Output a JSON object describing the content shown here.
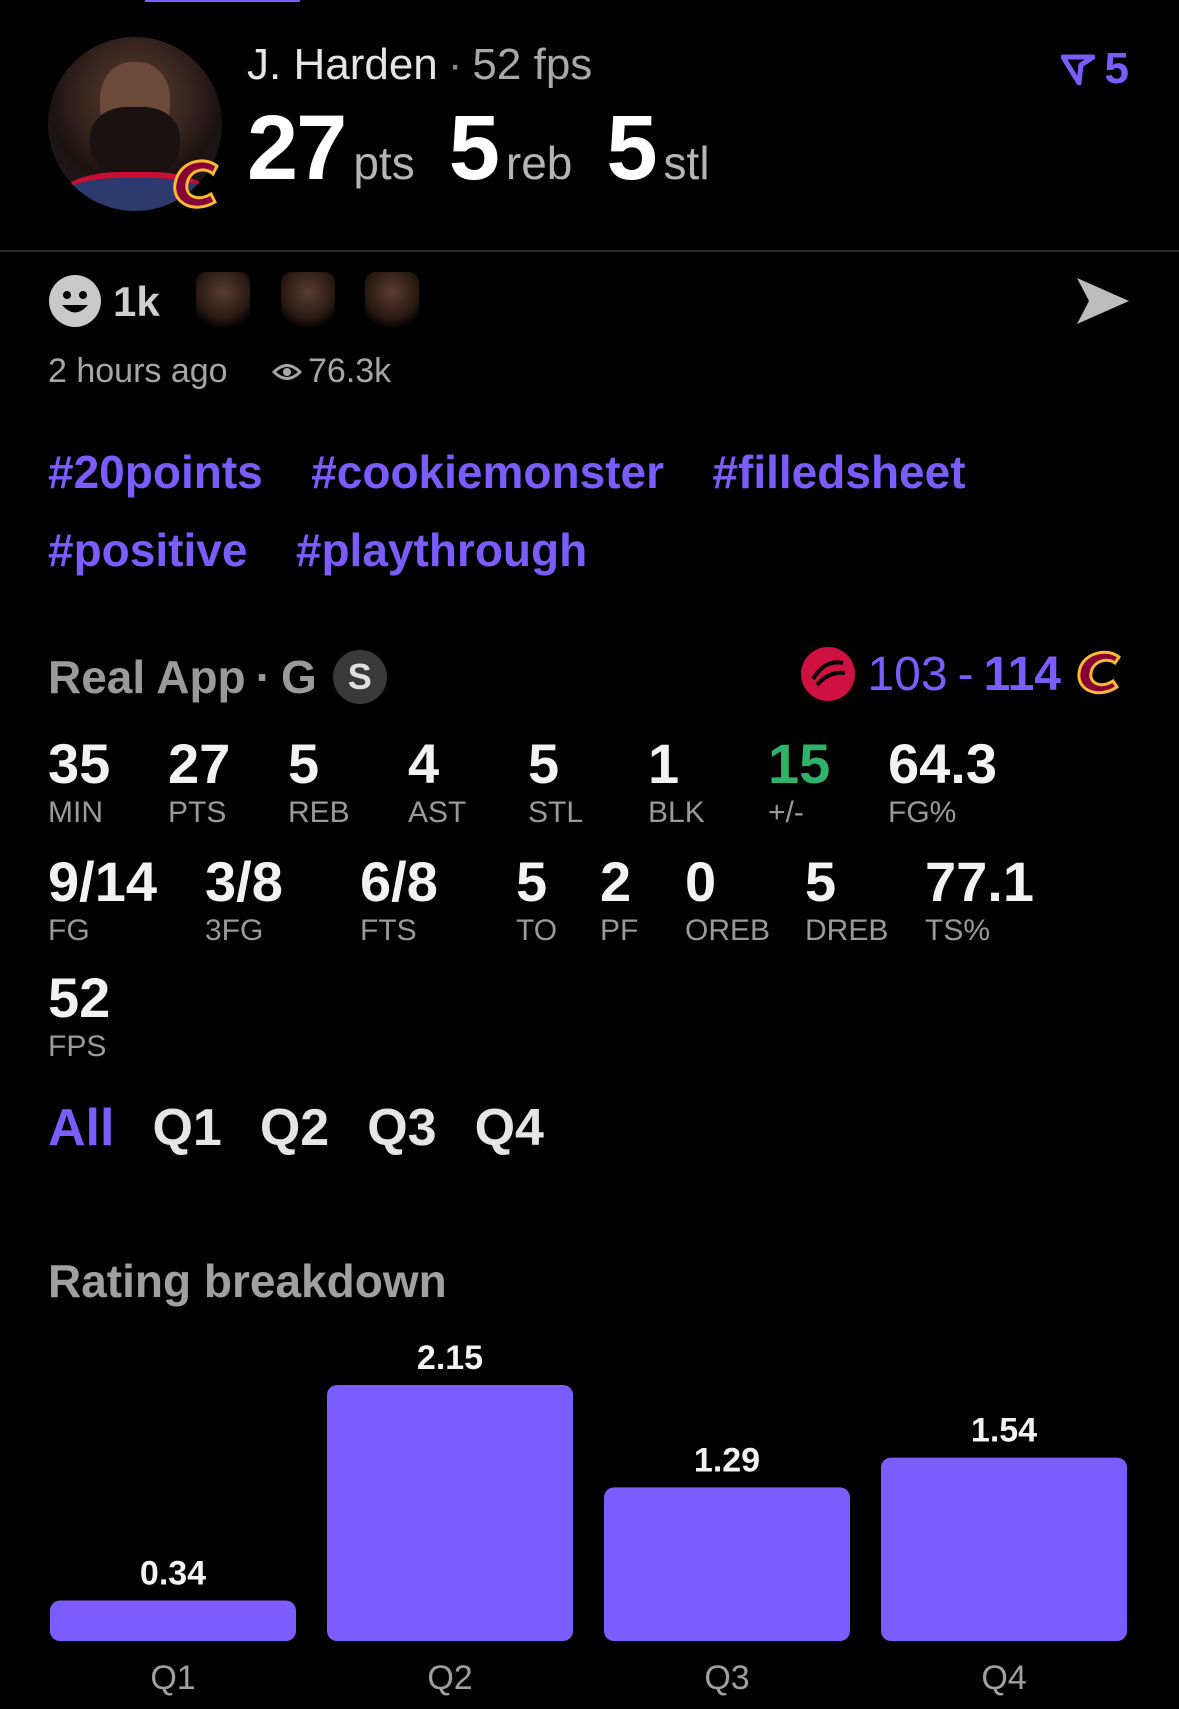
{
  "player": {
    "name": "J. Harden",
    "fps": "52 fps",
    "rank": "5",
    "headline": [
      {
        "value": "27",
        "unit": "pts"
      },
      {
        "value": "5",
        "unit": "reb"
      },
      {
        "value": "5",
        "unit": "stl"
      }
    ]
  },
  "reactions": {
    "count": "1k",
    "time": "2 hours ago",
    "views": "76.3k"
  },
  "hashtags": [
    "#20points",
    "#cookiemonster",
    "#filledsheet",
    "#positive",
    "#playthrough"
  ],
  "game": {
    "label": "Real App",
    "position": "G",
    "badge": "S",
    "away_score": "103",
    "home_score": "114"
  },
  "stats_row1": [
    {
      "value": "35",
      "label": "MIN"
    },
    {
      "value": "27",
      "label": "PTS"
    },
    {
      "value": "5",
      "label": "REB"
    },
    {
      "value": "4",
      "label": "AST"
    },
    {
      "value": "5",
      "label": "STL"
    },
    {
      "value": "1",
      "label": "BLK"
    },
    {
      "value": "15",
      "label": "+/-"
    },
    {
      "value": "64.3",
      "label": "FG%"
    }
  ],
  "stats_row2": [
    {
      "value": "9/14",
      "label": "FG"
    },
    {
      "value": "3/8",
      "label": "3FG"
    },
    {
      "value": "6/8",
      "label": "FTS"
    },
    {
      "value": "5",
      "label": "TO"
    },
    {
      "value": "2",
      "label": "PF"
    },
    {
      "value": "0",
      "label": "OREB"
    },
    {
      "value": "5",
      "label": "DREB"
    },
    {
      "value": "77.1",
      "label": "TS%"
    }
  ],
  "stats_row3": [
    {
      "value": "52",
      "label": "FPS"
    }
  ],
  "quarter_tabs": [
    "All",
    "Q1",
    "Q2",
    "Q3",
    "Q4"
  ],
  "rating": {
    "title": "Rating breakdown"
  },
  "colors": {
    "accent": "#7b5cff",
    "positive": "#2fb36b",
    "background": "#000000"
  },
  "chart_data": {
    "type": "bar",
    "title": "Rating breakdown",
    "categories": [
      "Q1",
      "Q2",
      "Q3",
      "Q4"
    ],
    "values": [
      0.34,
      2.15,
      1.29,
      1.54
    ],
    "data_labels": [
      "0.34",
      "2.15",
      "1.29",
      "1.54"
    ],
    "ylim": [
      0,
      2.15
    ],
    "grid": false
  }
}
